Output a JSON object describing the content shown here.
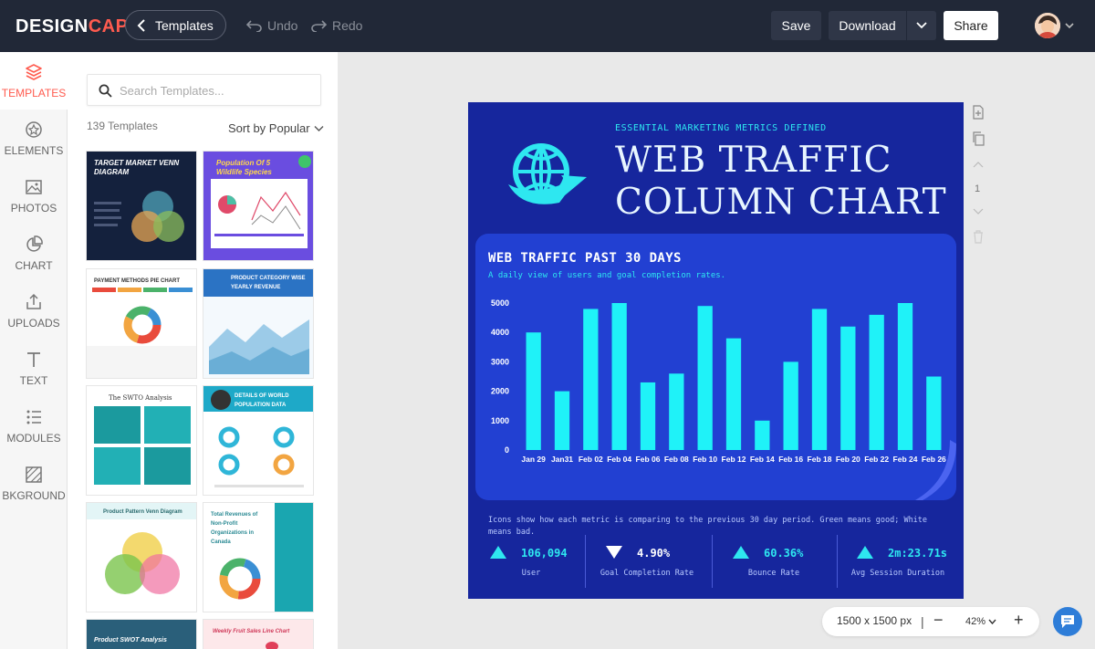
{
  "brand": {
    "logo_part1": "DESIGN",
    "logo_part2": "CAP",
    "accent": "#ff5b4f",
    "topbar_bg": "#212837"
  },
  "toolbar": {
    "templates_label": "Templates",
    "undo_label": "Undo",
    "redo_label": "Redo",
    "save_label": "Save",
    "download_label": "Download",
    "share_label": "Share"
  },
  "sidebar": {
    "items": [
      {
        "label": "TEMPLATES",
        "icon": "layers-icon",
        "active": true
      },
      {
        "label": "ELEMENTS",
        "icon": "elements-icon"
      },
      {
        "label": "PHOTOS",
        "icon": "photo-icon"
      },
      {
        "label": "CHART",
        "icon": "pie-chart-icon"
      },
      {
        "label": "UPLOADS",
        "icon": "upload-icon"
      },
      {
        "label": "TEXT",
        "icon": "text-icon"
      },
      {
        "label": "MODULES",
        "icon": "list-icon"
      },
      {
        "label": "BKGROUND",
        "icon": "background-icon"
      }
    ]
  },
  "panel": {
    "search_placeholder": "Search Templates...",
    "count": "139 Templates",
    "sort_label": "Sort by Popular",
    "templates": [
      {
        "title": "TARGET MARKET VENN DIAGRAM"
      },
      {
        "title": "Population Of 5 Wildlife Species"
      },
      {
        "title": "PAYMENT METHODS PIE CHART"
      },
      {
        "title": "PRODUCT CATEGORY WISE YEARLY REVENUE"
      },
      {
        "title": "The SWTO Analysis"
      },
      {
        "title": "DETAILS OF WORLD POPULATION DATA"
      },
      {
        "title": "Product Pattern Venn Diagram"
      },
      {
        "title": "Total Revenues of Non-Profit Organizations in Canada"
      },
      {
        "title": "Product SWOT Analysis"
      },
      {
        "title": "Weekly Fruit Sales Line Chart"
      }
    ]
  },
  "poster": {
    "kicker": "ESSENTIAL MARKETING METRICS DEFINED",
    "title_line1": "WEB TRAFFIC",
    "title_line2": "COLUMN CHART",
    "card_title": "WEB TRAFFIC PAST 30 DAYS",
    "card_subtitle": "A daily view of users and goal completion rates.",
    "description": "Icons show how each  metric  is comparing to the previous 30 day period. Green means good;  White means bad.",
    "metrics": [
      {
        "value": "106,094",
        "label": "User",
        "direction": "up"
      },
      {
        "value": "4.90%",
        "label": "Goal Completion Rate",
        "direction": "down"
      },
      {
        "value": "60.36%",
        "label": "Bounce Rate",
        "direction": "up"
      },
      {
        "value": "2m:23.71s",
        "label": "Avg Session Duration",
        "direction": "up"
      }
    ],
    "colors": {
      "background": "#16269d",
      "card": "#2240d2",
      "accent": "#2ee7f0"
    }
  },
  "chart_data": {
    "type": "bar",
    "title": "WEB TRAFFIC PAST 30 DAYS",
    "subtitle": "A daily view of users and goal completion rates.",
    "categories": [
      "Jan 29",
      "Jan31",
      "Feb 02",
      "Feb 04",
      "Feb 06",
      "Feb 08",
      "Feb 10",
      "Feb 12",
      "Feb 14",
      "Feb 16",
      "Feb 18",
      "Feb 20",
      "Feb 22",
      "Feb 24",
      "Feb 26"
    ],
    "values": [
      4000,
      2000,
      4800,
      5000,
      2300,
      2600,
      4900,
      3800,
      1000,
      3000,
      4800,
      4200,
      4600,
      5000,
      2500
    ],
    "yticks": [
      "0",
      "1000",
      "2000",
      "3000",
      "4000",
      "5000"
    ],
    "ylim": [
      0,
      5000
    ],
    "color": "#1ff2f8"
  },
  "canvas": {
    "dimensions": "1500 x 1500 px",
    "zoom": "42%",
    "page": "1"
  }
}
